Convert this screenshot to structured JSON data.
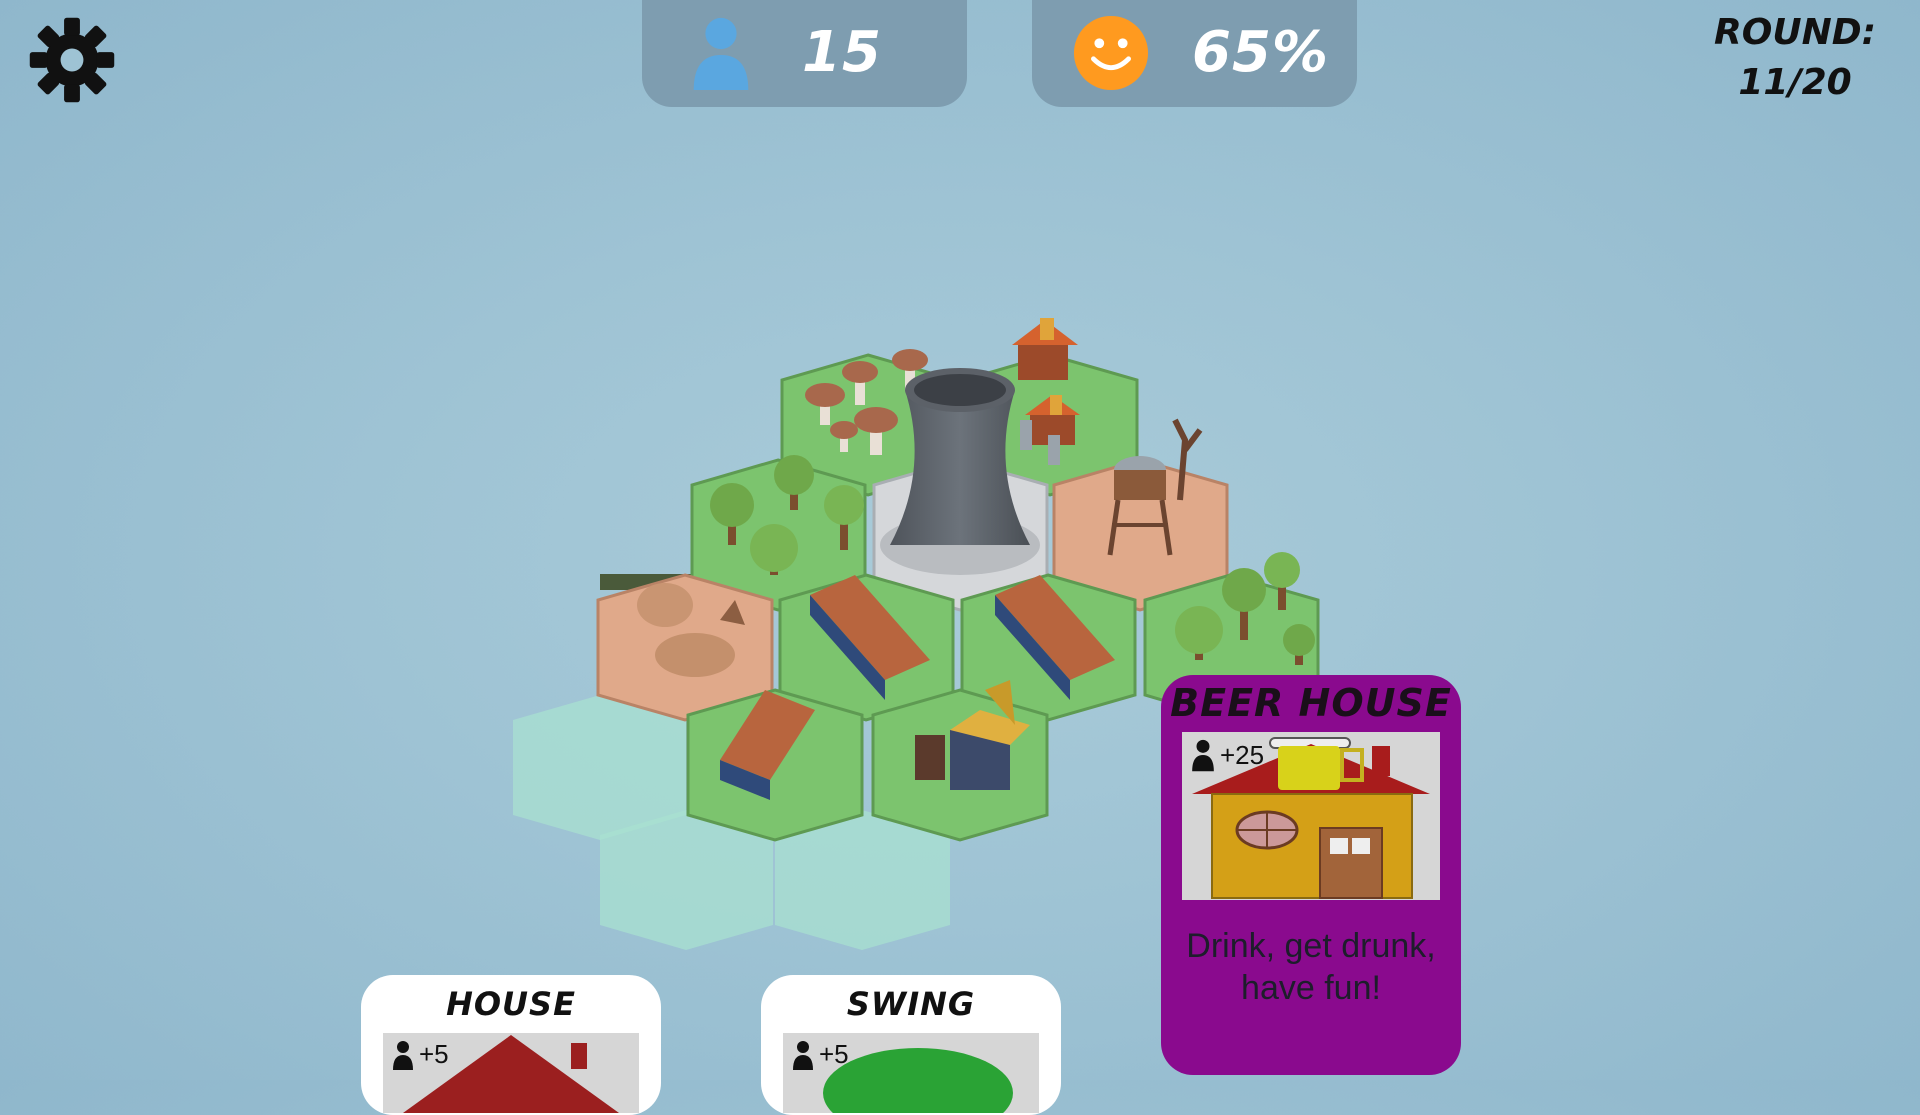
{
  "hud": {
    "settings_icon": "gear-icon",
    "population": {
      "icon": "person-icon",
      "value": "15",
      "icon_color": "#5aa7e0"
    },
    "happiness": {
      "icon": "smiley-icon",
      "value": "65%",
      "icon_color": "#ff9a1f"
    },
    "round": {
      "label": "ROUND:",
      "value": "11/20"
    }
  },
  "cards": {
    "house": {
      "title": "HOUSE",
      "stat": "+5",
      "stat_icon": "person-icon"
    },
    "swing": {
      "title": "SWING",
      "stat": "+5",
      "stat_icon": "person-icon"
    },
    "beer_house": {
      "title": "BEER HOUSE",
      "stat": "+25",
      "stat_icon": "person-icon",
      "description": "Drink, get drunk, have fun!",
      "color": "#8a0a8e"
    }
  },
  "colors": {
    "grass": "#7cc46e",
    "dirt": "#e0a98a",
    "placement_hex": "#a8e0d0",
    "background": "#9ec3d4"
  }
}
